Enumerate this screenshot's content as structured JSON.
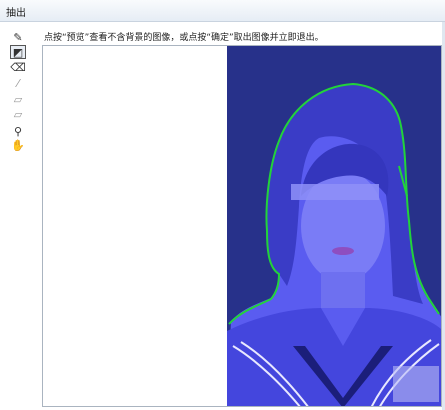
{
  "window": {
    "title": "抽出"
  },
  "hint": {
    "text": "点按“预览”查看不含背景的图像，或点按“确定”取出图像并立即退出。"
  },
  "tools": [
    {
      "name": "edge-highlighter-tool-icon",
      "glyph": "✎"
    },
    {
      "name": "fill-tool-icon",
      "glyph": "◩"
    },
    {
      "name": "eraser-tool-icon",
      "glyph": "⌫"
    },
    {
      "name": "eyedropper-tool-icon",
      "glyph": "⁄"
    },
    {
      "name": "cleanup-tool-icon",
      "glyph": "▱"
    },
    {
      "name": "edge-touchup-tool-icon",
      "glyph": "▱"
    },
    {
      "name": "zoom-tool-icon",
      "glyph": "⚲"
    },
    {
      "name": "hand-tool-icon",
      "glyph": "✋"
    }
  ],
  "colors": {
    "canvas_bg": "#ffffff",
    "photo_bg": "#27318a",
    "highlight_fill": "#5a5cf0",
    "edge_highlight": "#22d33a",
    "uniform_dark": "#1b1e7a"
  }
}
